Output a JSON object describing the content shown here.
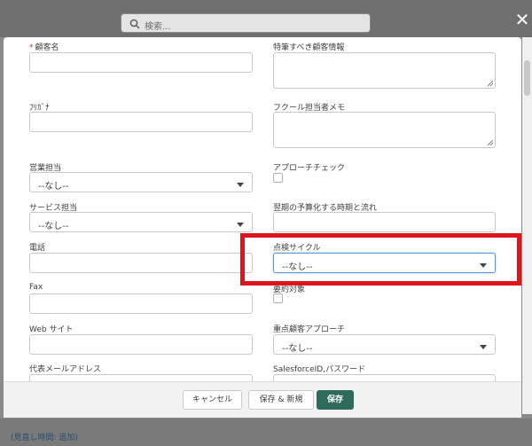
{
  "search": {
    "placeholder": "検索..."
  },
  "modal": {
    "left_fields": [
      {
        "label": "顧客名",
        "required": true,
        "type": "text",
        "value": ""
      },
      {
        "label": "ﾌﾘｶﾞﾅ",
        "type": "text",
        "value": ""
      },
      {
        "label": "営業担当",
        "type": "select",
        "value": "--なし--"
      },
      {
        "label": "サービス担当",
        "type": "select",
        "value": "--なし--"
      },
      {
        "label": "電話",
        "type": "text",
        "value": ""
      },
      {
        "label": "Fax",
        "type": "text",
        "value": ""
      },
      {
        "label": "Web サイト",
        "type": "text",
        "value": ""
      },
      {
        "label": "代表メールアドレス",
        "type": "text",
        "value": ""
      }
    ],
    "right_fields": [
      {
        "label": "特筆すべき顧客情報",
        "type": "textarea",
        "value": ""
      },
      {
        "label": "フクール担当者メモ",
        "type": "textarea",
        "value": ""
      },
      {
        "label": "アプローチチェック",
        "type": "checkbox",
        "checked": false
      },
      {
        "label": "翌期の予算化する時期と流れ",
        "type": "text",
        "value": ""
      },
      {
        "label": "点検サイクル",
        "type": "select",
        "value": "--なし--",
        "focused": true
      },
      {
        "label": "要約対象",
        "type": "checkbox",
        "checked": false
      },
      {
        "label": "重点顧客アプローチ",
        "type": "select",
        "value": "--なし--"
      },
      {
        "label": "SalesforceID,パスワード",
        "type": "text",
        "value": ""
      }
    ]
  },
  "footer": {
    "cancel_label": "キャンセル",
    "save_new_label": "保存 & 新規",
    "save_label": "保存"
  },
  "background": {
    "bottom_link": "(見直し時間: 追加)"
  },
  "colors": {
    "highlight": "#e0141b",
    "brand_button": "#2e6b5a",
    "focus_border": "#5a9bd5"
  }
}
